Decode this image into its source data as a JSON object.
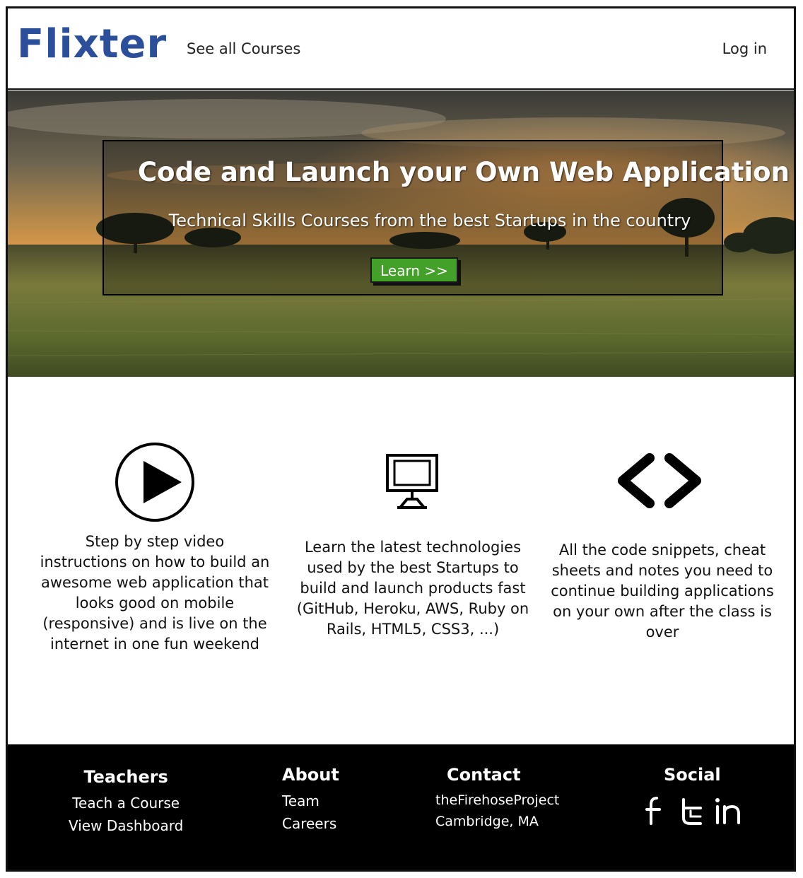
{
  "header": {
    "logo": "Flixter",
    "nav_courses": "See all Courses",
    "login": "Log in"
  },
  "hero": {
    "title": "Code and Launch your Own Web Application",
    "subtitle": "Technical Skills Courses from the best Startups in the country",
    "cta": "Learn >>"
  },
  "features": [
    {
      "icon": "play-icon",
      "text": "Step by step video instructions on how to build an awesome web application that looks good on mobile (responsive) and is live on the internet in one fun weekend"
    },
    {
      "icon": "monitor-icon",
      "text": "Learn the latest technologies used by the best Startups to build and launch products fast (GitHub, Heroku, AWS, Ruby on Rails, HTML5, CSS3, ...)"
    },
    {
      "icon": "code-brackets-icon",
      "text": "All the code snippets, cheat sheets and notes you need to continue building applications on your own after the class is over"
    }
  ],
  "footer": {
    "teachers": {
      "heading": "Teachers",
      "links": [
        "Teach a Course",
        "View Dashboard"
      ]
    },
    "about": {
      "heading": "About",
      "links": [
        "Team",
        "Careers"
      ]
    },
    "contact": {
      "heading": "Contact",
      "lines": [
        "theFirehoseProject",
        "Cambridge, MA"
      ]
    },
    "social": {
      "heading": "Social",
      "icons": [
        "facebook-icon",
        "twitter-icon",
        "linkedin-icon"
      ]
    }
  },
  "colors": {
    "logo": "#2b4f9a",
    "cta": "#43a12a",
    "footer_bg": "#000000"
  }
}
